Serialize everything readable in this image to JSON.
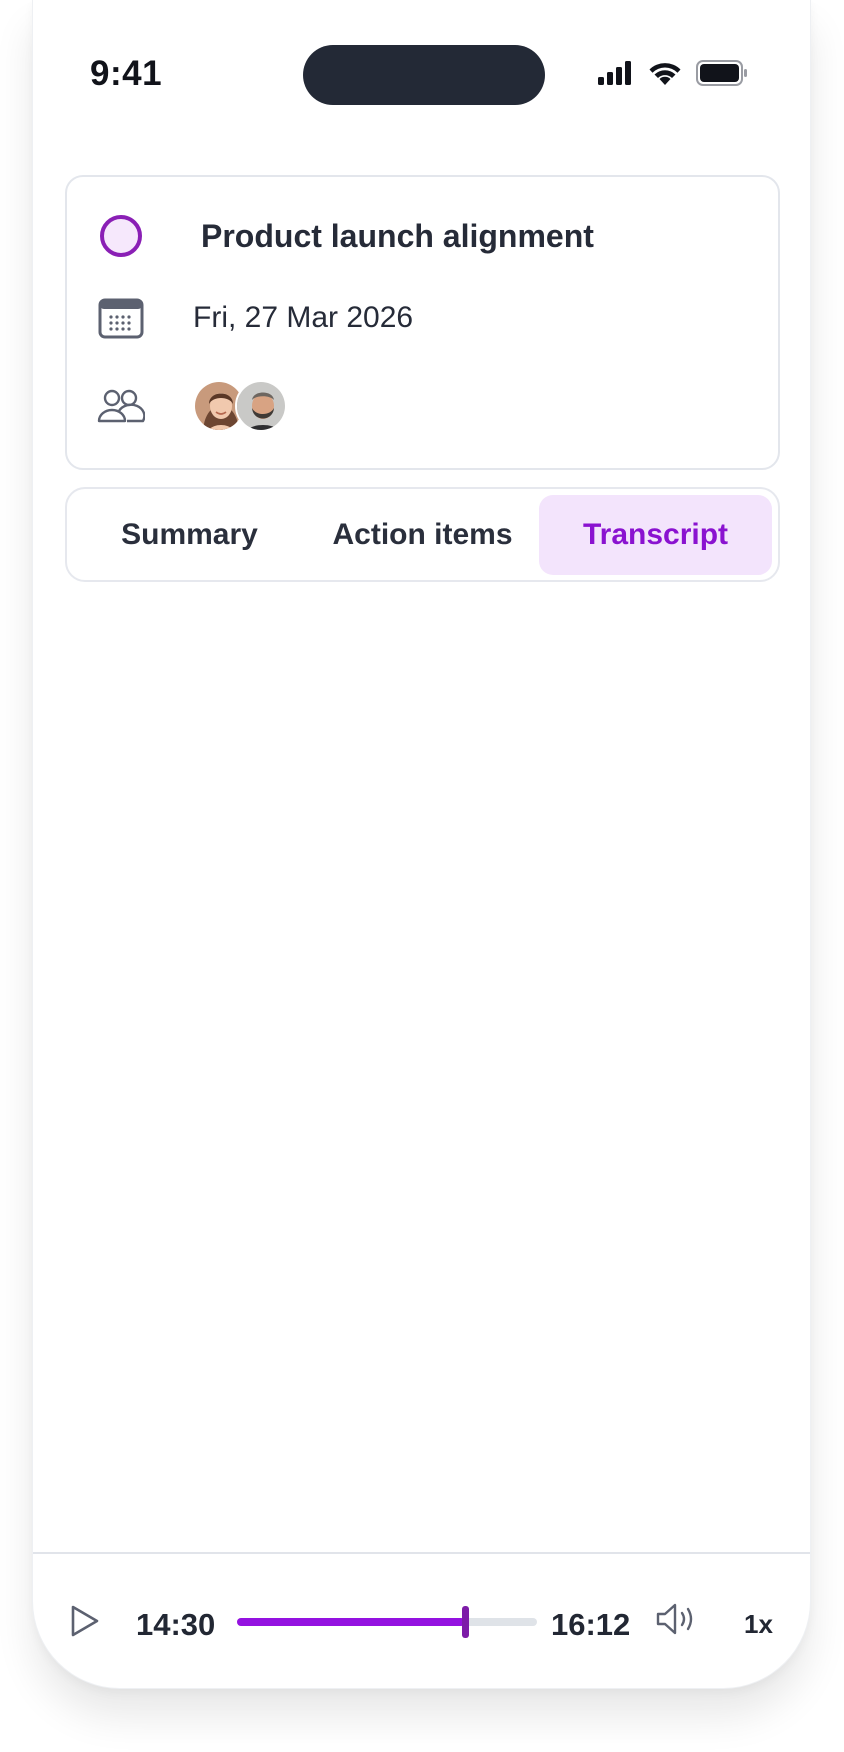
{
  "status_bar": {
    "time": "9:41",
    "icons": [
      "cellular-signal-icon",
      "wifi-icon",
      "battery-icon"
    ]
  },
  "meeting": {
    "status_icon": "status-circle-icon",
    "title": "Product launch alignment",
    "date": "Fri, 27 Mar 2026",
    "date_icon": "calendar-icon",
    "participants_icon": "people-icon",
    "participants": [
      {
        "name": "participant-1"
      },
      {
        "name": "participant-2"
      }
    ]
  },
  "tabs": [
    {
      "label": "Summary",
      "active": false
    },
    {
      "label": "Action items",
      "active": false
    },
    {
      "label": "Transcript",
      "active": true
    }
  ],
  "player": {
    "current_time": "14:30",
    "total_time": "16:12",
    "progress_fraction": 0.76,
    "speed": "1x",
    "icons": [
      "play-icon",
      "volume-icon"
    ]
  },
  "colors": {
    "accent": "#8a12d0",
    "accent_bg": "#f3e4fc",
    "text": "#262b38",
    "border": "#e3e6ec"
  }
}
